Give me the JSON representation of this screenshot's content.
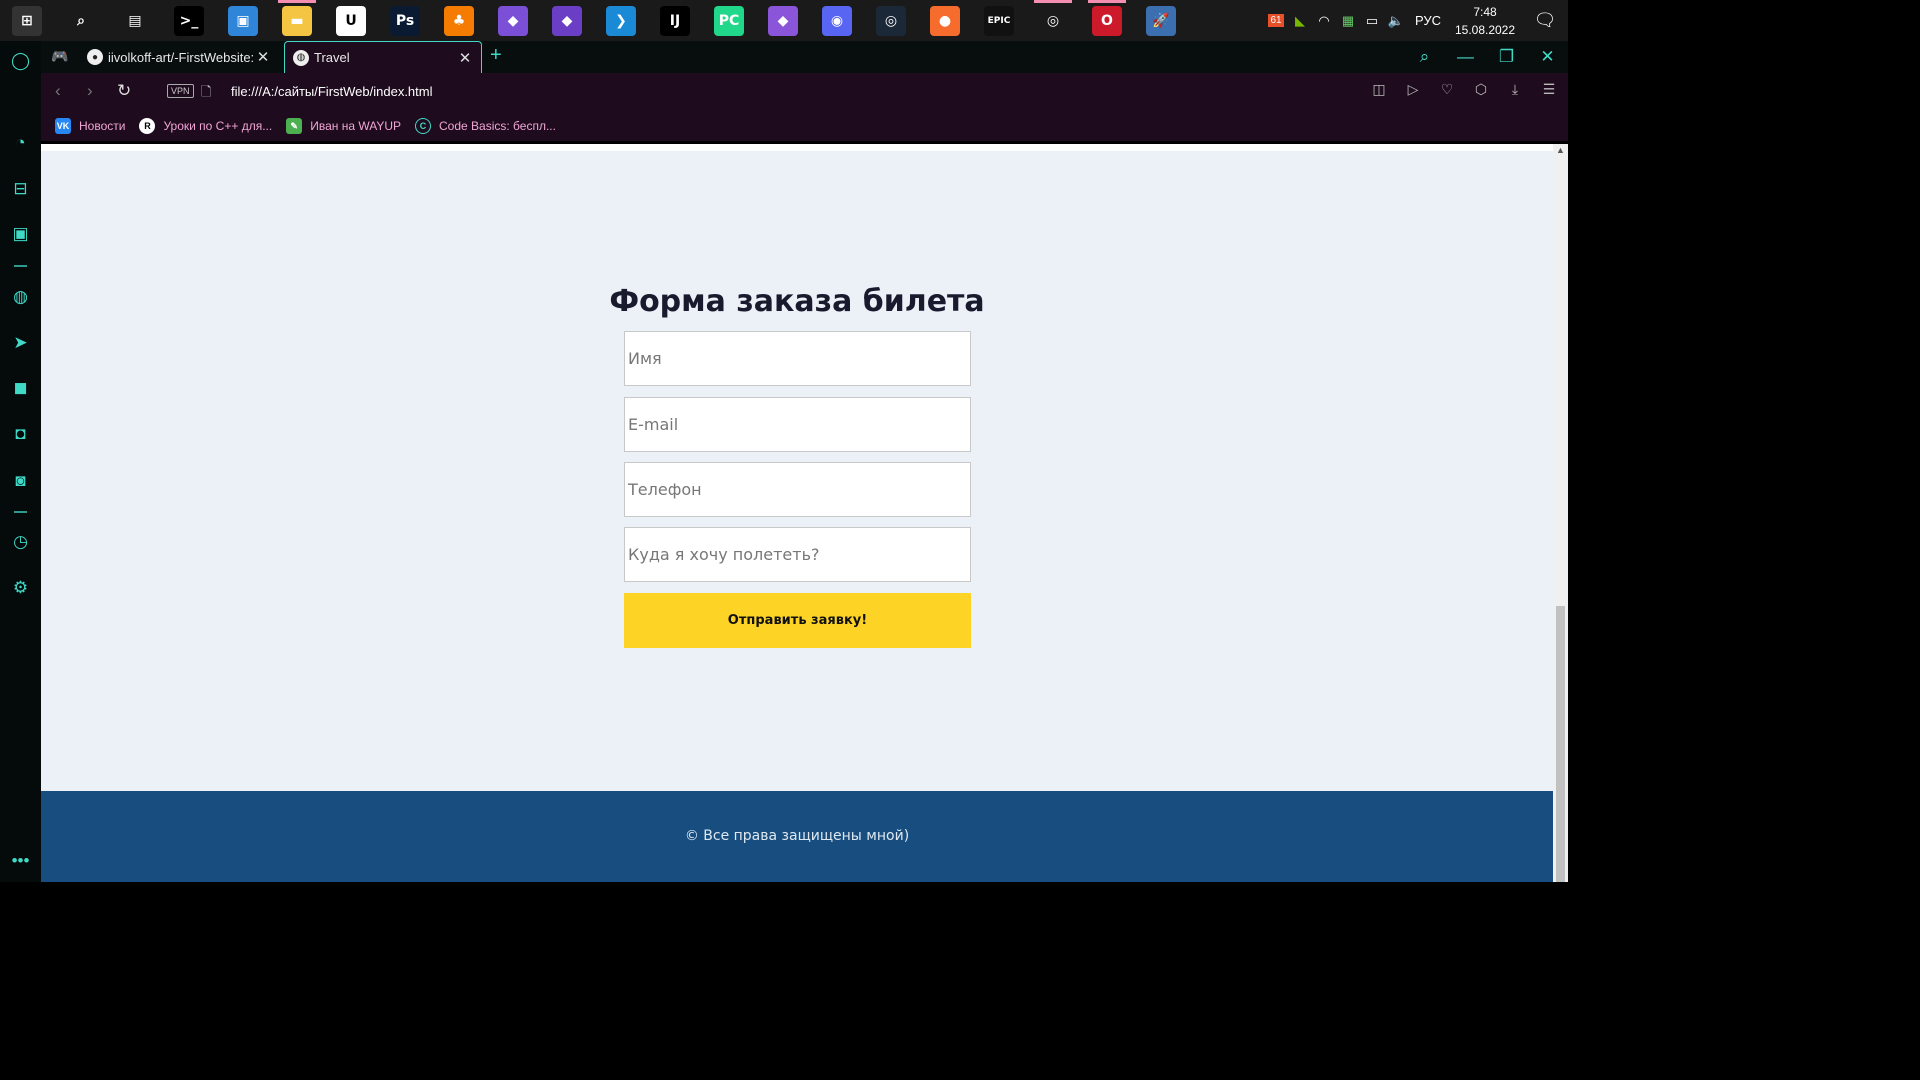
{
  "taskbar": {
    "apps": [
      {
        "name": "start-icon",
        "glyph": "⊞",
        "color": "#333333"
      },
      {
        "name": "search-icon",
        "glyph": "⌕",
        "color": "#1a1a1a"
      },
      {
        "name": "task-view-icon",
        "glyph": "▤",
        "color": "#1a1a1a"
      },
      {
        "name": "terminal-icon",
        "glyph": ">_",
        "color": "#000000"
      },
      {
        "name": "control-panel-icon",
        "glyph": "▣",
        "color": "#2f86d8"
      },
      {
        "name": "file-explorer-icon",
        "glyph": "▬",
        "color": "#f4c542"
      },
      {
        "name": "unreal-engine-icon",
        "glyph": "U",
        "color": "#ffffff"
      },
      {
        "name": "photoshop-icon",
        "glyph": "Ps",
        "color": "#0a1a33"
      },
      {
        "name": "fl-studio-icon",
        "glyph": "♣",
        "color": "#f57c00"
      },
      {
        "name": "visual-studio-installer-icon",
        "glyph": "◆",
        "color": "#7b4fd6"
      },
      {
        "name": "visual-studio-icon",
        "glyph": "◆",
        "color": "#6a3fc5"
      },
      {
        "name": "vscode-icon",
        "glyph": "❯",
        "color": "#1b8ad6"
      },
      {
        "name": "intellij-icon",
        "glyph": "IJ",
        "color": "#000000"
      },
      {
        "name": "pycharm-icon",
        "glyph": "PC",
        "color": "#21d789"
      },
      {
        "name": "visual-studio-2-icon",
        "glyph": "◆",
        "color": "#8b55d9"
      },
      {
        "name": "discord-icon",
        "glyph": "◉",
        "color": "#5865f2"
      },
      {
        "name": "steam-icon",
        "glyph": "◎",
        "color": "#1b2838"
      },
      {
        "name": "origin-icon",
        "glyph": "●",
        "color": "#f56c2d"
      },
      {
        "name": "epic-games-icon",
        "glyph": "EPIC",
        "color": "#111111"
      },
      {
        "name": "ubisoft-icon",
        "glyph": "◎",
        "color": "#1a1a1a"
      },
      {
        "name": "opera-icon",
        "glyph": "O",
        "color": "#cc1a2a"
      },
      {
        "name": "python-launcher-icon",
        "glyph": "🚀",
        "color": "#3b6fb0"
      }
    ],
    "tray": {
      "badge": "61",
      "language": "РУС",
      "time": "7:48",
      "date": "15.08.2022"
    }
  },
  "browser": {
    "tabs": [
      {
        "label": "iivolkoff-art/-FirstWebsite: ",
        "icon": "github"
      },
      {
        "label": "Travel",
        "icon": "globe"
      }
    ],
    "address": {
      "vpn_label": "VPN",
      "url": "file:///A:/сайты/FirstWeb/index.html"
    },
    "bookmarks": [
      {
        "label": "Новости",
        "icon_text": "VK",
        "color": "#2787f5"
      },
      {
        "label": "Уроки по С++ для...",
        "icon_text": "R",
        "color": "#ffffff"
      },
      {
        "label": "Иван на WAYUP",
        "icon_text": "✎",
        "color": "#4caf50"
      },
      {
        "label": "Code Basics: беспл...",
        "icon_text": "C",
        "color": "#1e0b1e"
      }
    ]
  },
  "page": {
    "form": {
      "title": "Форма заказа билета",
      "name_placeholder": "Имя",
      "email_placeholder": "E-mail",
      "phone_placeholder": "Телефон",
      "destination_placeholder": "Куда я хочу полететь?",
      "submit_label": "Отправить заявку!"
    },
    "footer_text": "© Все права защищены мной)"
  },
  "colors": {
    "accent": "#3fd9c6",
    "submit_bg": "#fdd426",
    "footer_bg": "#174e7f",
    "page_bg": "#ebf1f7"
  }
}
